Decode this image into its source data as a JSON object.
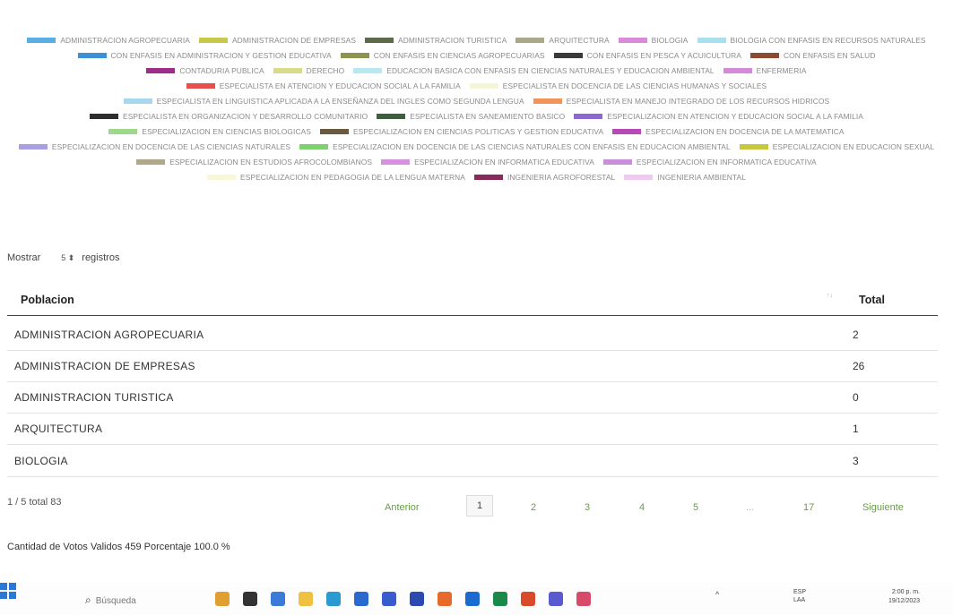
{
  "legend": [
    {
      "label": "ADMINISTRACION AGROPECUARIA",
      "color": "#5aaee6"
    },
    {
      "label": "ADMINISTRACION DE EMPRESAS",
      "color": "#c8c84a"
    },
    {
      "label": "ADMINISTRACION TURISTICA",
      "color": "#5f6a4a"
    },
    {
      "label": "ARQUITECTURA",
      "color": "#a9a98a"
    },
    {
      "label": "BIOLOGIA",
      "color": "#d98ad9"
    },
    {
      "label": "BIOLOGIA CON ENFASIS EN RECURSOS NATURALES",
      "color": "#a8e0f0"
    },
    {
      "label": "CON ENFASIS EN ADMINISTRACION Y GESTION EDUCATIVA",
      "color": "#3d8fd6"
    },
    {
      "label": "CON ENFASIS EN CIENCIAS AGROPECUARIAS",
      "color": "#8c9450"
    },
    {
      "label": "CON ENFASIS EN PESCA Y ACUICULTURA",
      "color": "#3a3a3a"
    },
    {
      "label": "CON ENFASIS EN SALUD",
      "color": "#8b4a32"
    },
    {
      "label": "CONTADURIA PUBLICA",
      "color": "#9c2e8a"
    },
    {
      "label": "DERECHO",
      "color": "#d8dc8a"
    },
    {
      "label": "EDUCACION BASICA CON ENFASIS EN CIENCIAS NATURALES Y EDUCACION AMBIENTAL",
      "color": "#b8e8f0"
    },
    {
      "label": "ENFERMERIA",
      "color": "#d58ad8"
    },
    {
      "label": "ESPECIALISTA EN ATENCION Y EDUCACION SOCIAL A LA FAMILIA",
      "color": "#e85050"
    },
    {
      "label": "ESPECIALISTA EN DOCENCIA DE LAS CIENCIAS HUMANAS Y SOCIALES",
      "color": "#f5f5d8"
    },
    {
      "label": "ESPECIALISTA EN LINGUISTICA APLICADA A LA ENSEÑANZA DEL INGLES COMO SEGUNDA LENGUA",
      "color": "#a8d8f0"
    },
    {
      "label": "ESPECIALISTA EN MANEJO INTEGRADO DE LOS RECURSOS HIDRICOS",
      "color": "#f0945a"
    },
    {
      "label": "ESPECIALISTA EN ORGANIZACION Y DESARROLLO COMUNITARIO",
      "color": "#2e2e2e"
    },
    {
      "label": "ESPECIALISTA EN SANEAMIENTO BASICO",
      "color": "#3e5e3e"
    },
    {
      "label": "ESPECIALIZACION EN ATENCION Y EDUCACION SOCIAL A LA FAMILIA",
      "color": "#8a6ad0"
    },
    {
      "label": "ESPECIALIZACION EN CIENCIAS BIOLOGICAS",
      "color": "#9ed88a"
    },
    {
      "label": "ESPECIALIZACION EN CIENCIAS POLITICAS Y GESTION EDUCATIVA",
      "color": "#6a5a40"
    },
    {
      "label": "ESPECIALIZACION EN DOCENCIA DE LA MATEMATICA",
      "color": "#b84ab8"
    },
    {
      "label": "ESPECIALIZACION EN DOCENCIA DE LAS CIENCIAS NATURALES",
      "color": "#a8a0e0"
    },
    {
      "label": "ESPECIALIZACION EN DOCENCIA DE LAS CIENCIAS NATURALES CON ENFASIS EN EDUCACION AMBIENTAL",
      "color": "#7ed070"
    },
    {
      "label": "ESPECIALIZACION EN EDUCACION SEXUAL",
      "color": "#c8c840"
    },
    {
      "label": "ESPECIALIZACION EN ESTUDIOS AFROCOLOMBIANOS",
      "color": "#b0a888"
    },
    {
      "label": "ESPECIALIZACION EN INFORMATICA EDUCATIVA",
      "color": "#d890e0"
    },
    {
      "label": "ESPECIALIZACION EN INFORMATICA EDUCATIVA",
      "color": "#c890d8"
    },
    {
      "label": "ESPECIALIZACION EN PEDAGOGIA DE LA LENGUA MATERNA",
      "color": "#f8f8d8"
    },
    {
      "label": "INGENIERIA AGROFORESTAL",
      "color": "#8a2a5a"
    },
    {
      "label": "INGENIERIA AMBIENTAL",
      "color": "#f0c8f0"
    }
  ],
  "mostrar": {
    "prefix": "Mostrar",
    "value": "5",
    "suffix": "registros"
  },
  "table": {
    "col_poblacion": "Poblacion",
    "col_total": "Total",
    "sort_glyph": "↑↓",
    "rows": [
      {
        "name": "ADMINISTRACION AGROPECUARIA",
        "total": "2"
      },
      {
        "name": "ADMINISTRACION DE EMPRESAS",
        "total": "26"
      },
      {
        "name": "ADMINISTRACION TURISTICA",
        "total": "0"
      },
      {
        "name": "ARQUITECTURA",
        "total": "1"
      },
      {
        "name": "BIOLOGIA",
        "total": "3"
      }
    ]
  },
  "info": "1 / 5 total 83",
  "pagination": {
    "prev": "Anterior",
    "next": "Siguiente",
    "pages": [
      "1",
      "2",
      "3",
      "4",
      "5"
    ],
    "ellipsis": "...",
    "last": "17",
    "active": "1"
  },
  "votos": "Cantidad de Votos Validos  459 Porcentaje 100.0 %",
  "taskbar": {
    "search_placeholder": "Búsqueda",
    "lang_top": "ESP",
    "lang_bottom": "LAA",
    "time": "2:00 p. m.",
    "date": "19/12/2023",
    "apps": [
      {
        "name": "widgets-icon",
        "color": "#e0a030"
      },
      {
        "name": "terminal-icon",
        "color": "#333333"
      },
      {
        "name": "chat-icon",
        "color": "#3a7ad8"
      },
      {
        "name": "file-explorer-icon",
        "color": "#f0c040"
      },
      {
        "name": "edge-icon",
        "color": "#2a9ad0"
      },
      {
        "name": "store-icon",
        "color": "#2a6ad0"
      },
      {
        "name": "lumen-icon",
        "color": "#3a5ad0"
      },
      {
        "name": "dropbox-icon",
        "color": "#2a4ab0"
      },
      {
        "name": "firefox-icon",
        "color": "#e86a2a"
      },
      {
        "name": "outlook-icon",
        "color": "#1a6ad0"
      },
      {
        "name": "excel-icon",
        "color": "#1a8a4a"
      },
      {
        "name": "powerpoint-icon",
        "color": "#d84a2a"
      },
      {
        "name": "teams-icon",
        "color": "#5a5ad0"
      },
      {
        "name": "snip-icon",
        "color": "#d84a6a"
      }
    ]
  }
}
